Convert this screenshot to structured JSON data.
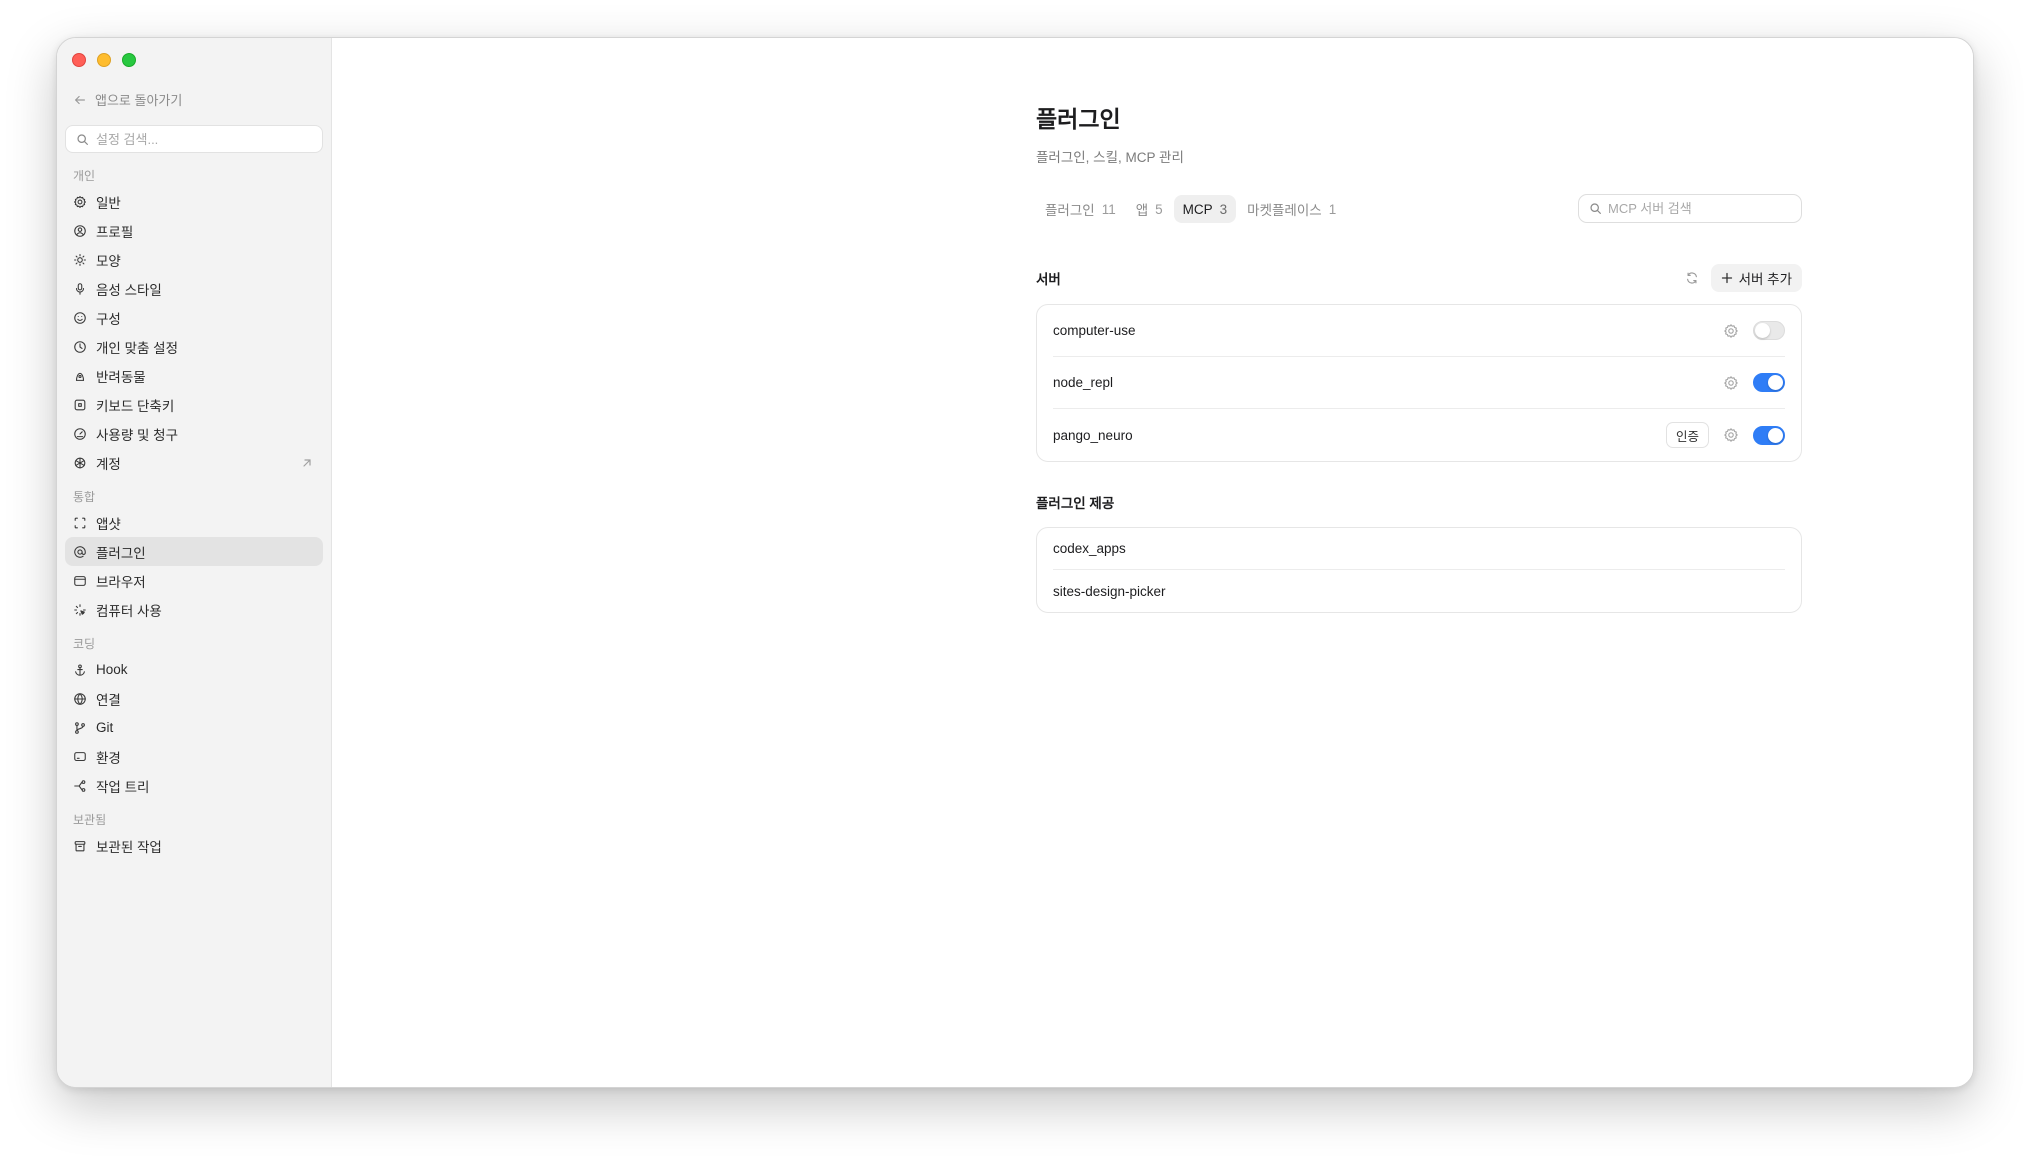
{
  "sidebar": {
    "back_label": "앱으로 돌아가기",
    "search_placeholder": "설정 검색...",
    "sections": [
      {
        "label": "개인",
        "items": [
          {
            "label": "일반",
            "icon": "gear-icon"
          },
          {
            "label": "프로필",
            "icon": "profile-icon"
          },
          {
            "label": "모양",
            "icon": "sun-icon"
          },
          {
            "label": "음성 스타일",
            "icon": "microphone-icon"
          },
          {
            "label": "구성",
            "icon": "smile-icon"
          },
          {
            "label": "개인 맞춤 설정",
            "icon": "clock-icon"
          },
          {
            "label": "반려동물",
            "icon": "pet-icon"
          },
          {
            "label": "키보드 단축키",
            "icon": "keyboard-icon"
          },
          {
            "label": "사용량 및 청구",
            "icon": "gauge-icon"
          },
          {
            "label": "계정",
            "icon": "openai-icon",
            "external": true
          }
        ]
      },
      {
        "label": "통합",
        "items": [
          {
            "label": "앱샷",
            "icon": "screenshot-icon"
          },
          {
            "label": "플러그인",
            "icon": "at-icon",
            "active": true
          },
          {
            "label": "브라우저",
            "icon": "browser-icon"
          },
          {
            "label": "컴퓨터 사용",
            "icon": "sparkle-cursor-icon"
          }
        ]
      },
      {
        "label": "코딩",
        "items": [
          {
            "label": "Hook",
            "icon": "anchor-icon"
          },
          {
            "label": "연결",
            "icon": "globe-icon"
          },
          {
            "label": "Git",
            "icon": "git-branch-icon"
          },
          {
            "label": "환경",
            "icon": "monitor-icon"
          },
          {
            "label": "작업 트리",
            "icon": "tree-icon"
          }
        ]
      },
      {
        "label": "보관됨",
        "items": [
          {
            "label": "보관된 작업",
            "icon": "archive-icon"
          }
        ]
      }
    ]
  },
  "main": {
    "title": "플러그인",
    "subtitle": "플러그인, 스킬, MCP 관리",
    "tabs": [
      {
        "label": "플러그인",
        "count": "11"
      },
      {
        "label": "앱",
        "count": "5"
      },
      {
        "label": "MCP",
        "count": "3",
        "active": true
      },
      {
        "label": "마켓플레이스",
        "count": "1"
      }
    ],
    "mcp_search_placeholder": "MCP 서버 검색",
    "servers_title": "서버",
    "add_server_label": "서버 추가",
    "servers": [
      {
        "name": "computer-use",
        "enabled": false,
        "auth": false
      },
      {
        "name": "node_repl",
        "enabled": true,
        "auth": false
      },
      {
        "name": "pango_neuro",
        "enabled": true,
        "auth": true,
        "auth_label": "인증"
      }
    ],
    "plugin_provided_title": "플러그인 제공",
    "plugin_provided": [
      {
        "name": "codex_apps"
      },
      {
        "name": "sites-design-picker"
      }
    ]
  },
  "colors": {
    "accent": "#2f7df6",
    "sidebar_bg": "#f3f3f3",
    "traffic_close": "#ff5f57",
    "traffic_min": "#febc2e",
    "traffic_max": "#28c840"
  }
}
